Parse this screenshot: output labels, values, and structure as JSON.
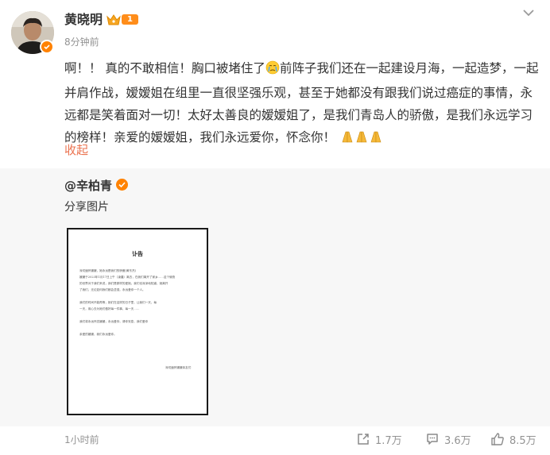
{
  "post": {
    "author": "黄晓明",
    "level_badge": "1",
    "time": "8分钟前",
    "text_line1": "啊！！ 真的不敢相信！胸口被堵住了",
    "text_rest": "前阵子我们还在一起建设月海，一起造梦，一起并肩作战，嫒嫒姐在组里一直很坚强乐观，甚至于她都没有跟我们说过癌症的事情，永远都是笑着面对一切！太好太善良的嫒嫒姐了，是我们青岛人的骄傲，是我们永远学习的榜样！亲爱的嫒嫒姐，我们永远爱你，怀念你！",
    "collapse_label": "收起",
    "icons": {
      "crown": "crown-icon",
      "sad_emoji": "crying-face-emoji",
      "pray": "pray-emoji",
      "more": "chevron-down-icon",
      "verified": "verified-badge-icon"
    }
  },
  "repost": {
    "author": "@辛柏青",
    "text": "分享图片",
    "doc": {
      "title": "讣告",
      "lines": [
        "深切缅怀嫒嫒，她永远是我们的骄傲(黄东杰)",
        "嫒嫒于2023年1月17日上午（凌晨）离去，在我们离开了家乡……这个愉快",
        "的世界对于我们来说，我们是那样的爱她，我们也深深地知道，她离开",
        "了我们，无论如何我们都会坚强，永远爱你一个人。",
        "",
        "我们的时间不能再等，她们在这样的日子里，让我们一天，每",
        "一天，用心去为她们做好每一件事，每一天……",
        "",
        "我们将永远怀念嫒嫒，永远爱你，请你安息，我们爱你",
        "",
        "亲爱的嫒嫒，我们永远爱你。"
      ],
      "signature": "深切缅怀嫒嫒亲友们"
    }
  },
  "footer": {
    "time": "1小时前",
    "shares": "1.7万",
    "comments": "3.6万",
    "likes": "8.5万"
  },
  "colors": {
    "orange": "#ff8200",
    "link": "#eb7350",
    "gray": "#939393",
    "repost_bg": "#f7f7f7"
  }
}
